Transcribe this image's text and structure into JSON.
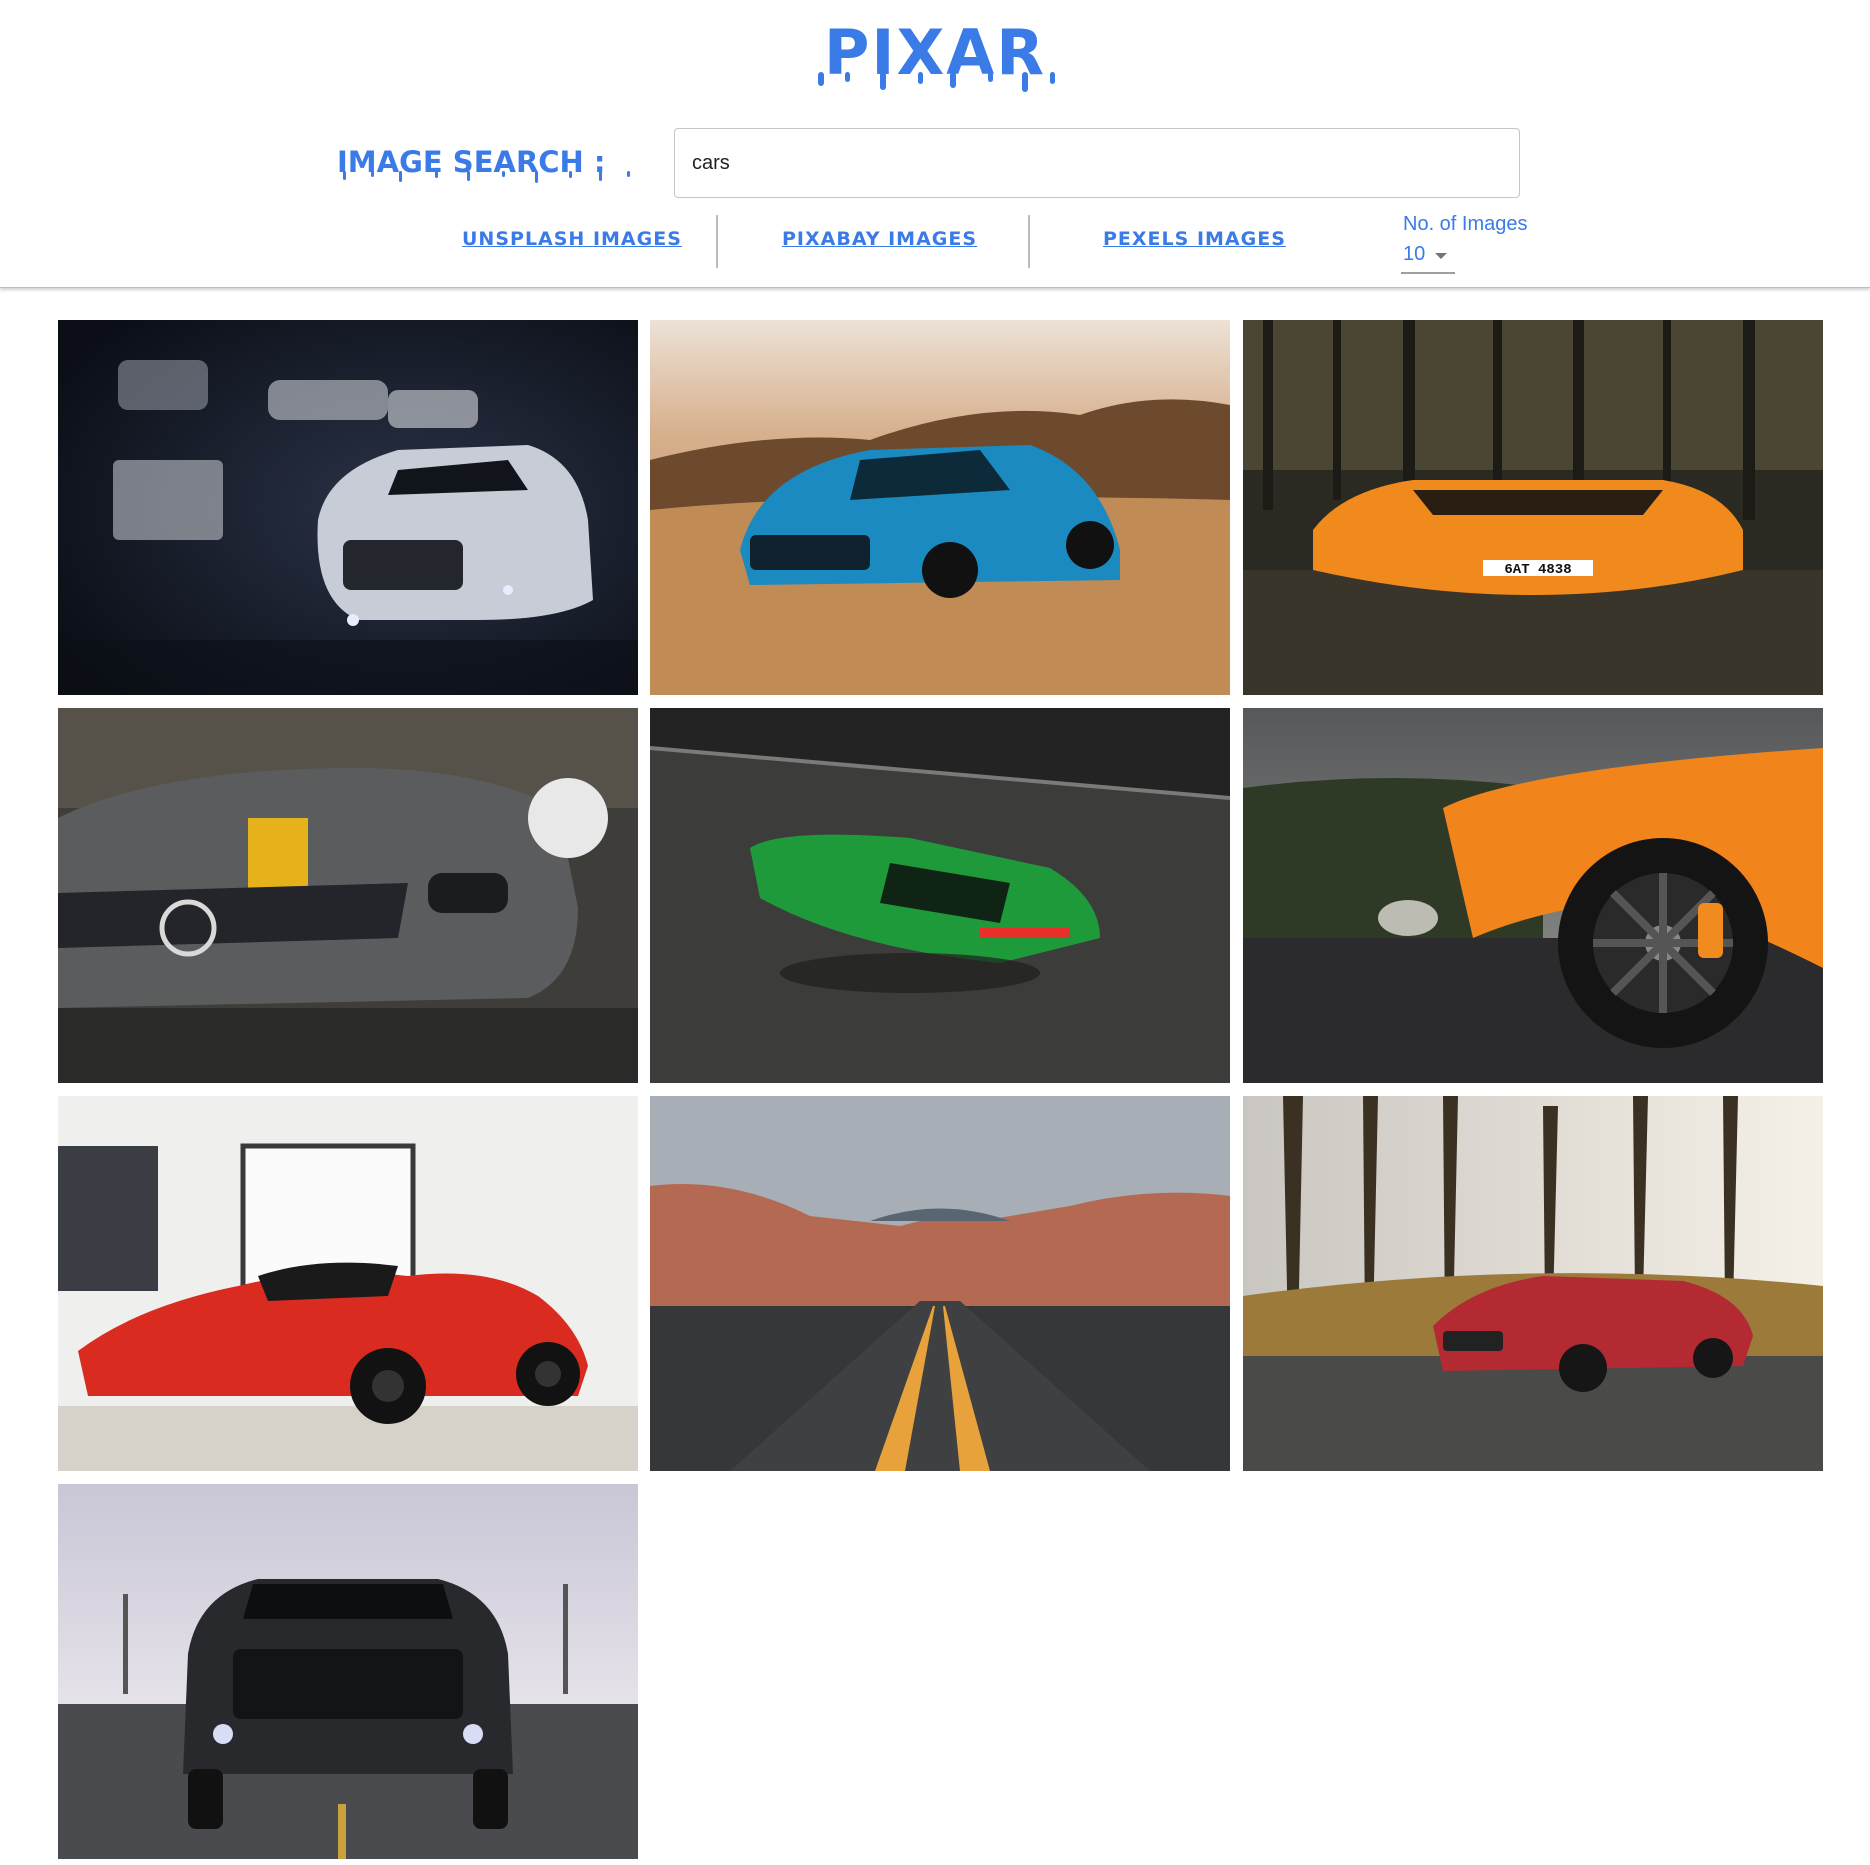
{
  "app": {
    "logo_text": "PIXAR",
    "brand_color": "#3b7be8"
  },
  "search": {
    "label": "IMAGE SEARCH :",
    "value": "cars"
  },
  "providers": [
    {
      "label": "UNSPLASH IMAGES"
    },
    {
      "label": "PIXABAY IMAGES"
    },
    {
      "label": "PEXELS IMAGES"
    }
  ],
  "count": {
    "label": "No. of Images",
    "value": "10"
  },
  "results": [
    {
      "subject": "white sports car in dark garage"
    },
    {
      "subject": "blue sports car in desert"
    },
    {
      "subject": "orange supercar in forest"
    },
    {
      "subject": "grey car with yellow stripe"
    },
    {
      "subject": "green muscle car from above"
    },
    {
      "subject": "orange supercar wheel close-up"
    },
    {
      "subject": "red hypercar in showroom"
    },
    {
      "subject": "desert road"
    },
    {
      "subject": "red sports car by trees"
    },
    {
      "subject": "black muscle car front view"
    }
  ],
  "tile_license_plate": "6AT 4838"
}
